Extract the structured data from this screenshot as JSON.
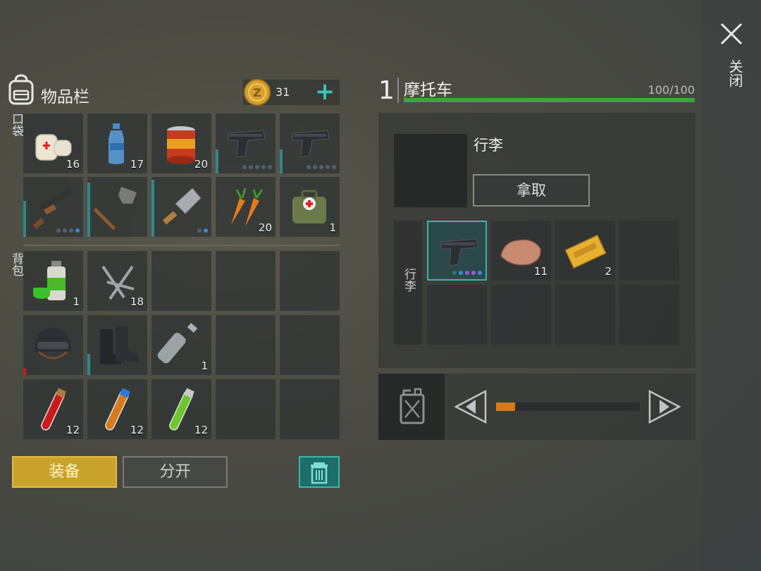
{
  "close": {
    "label": "关闭"
  },
  "inventory": {
    "title": "物品栏",
    "coins": "31",
    "pocket_label": "口袋",
    "backpack_label": "背包",
    "pocket_slots": [
      {
        "icon": "bandage-icon",
        "qty": "16"
      },
      {
        "icon": "water-bottle-icon",
        "qty": "17"
      },
      {
        "icon": "canned-food-icon",
        "qty": "20"
      },
      {
        "icon": "pistol-icon",
        "qty": ""
      },
      {
        "icon": "pistol-icon",
        "qty": ""
      },
      {
        "icon": "shotgun-icon",
        "qty": ""
      },
      {
        "icon": "shovel-icon",
        "qty": ""
      },
      {
        "icon": "cleaver-icon",
        "qty": ""
      },
      {
        "icon": "carrot-icon",
        "qty": "20"
      },
      {
        "icon": "medkit-bag-icon",
        "qty": "1"
      }
    ],
    "backpack_slots": [
      {
        "icon": "spray-paint-icon",
        "qty": "1"
      },
      {
        "icon": "nails-icon",
        "qty": "18"
      },
      {
        "icon": "",
        "qty": ""
      },
      {
        "icon": "",
        "qty": ""
      },
      {
        "icon": "",
        "qty": ""
      },
      {
        "icon": "helmet-icon",
        "qty": ""
      },
      {
        "icon": "boots-icon",
        "qty": ""
      },
      {
        "icon": "empty-bottle-icon",
        "qty": "1"
      },
      {
        "icon": "",
        "qty": ""
      },
      {
        "icon": "",
        "qty": ""
      },
      {
        "icon": "red-vial-icon",
        "qty": "12"
      },
      {
        "icon": "orange-vial-icon",
        "qty": "12"
      },
      {
        "icon": "green-vial-icon",
        "qty": "12"
      },
      {
        "icon": "",
        "qty": ""
      },
      {
        "icon": "",
        "qty": ""
      }
    ],
    "equip_label": "装备",
    "split_label": "分开"
  },
  "vehicle": {
    "number": "1",
    "name": "摩托车",
    "durability_text": "100/100",
    "durability_fraction": 1.0,
    "storage_name": "行李",
    "take_label": "拿取",
    "storage_side_label": "行李",
    "storage_slots": [
      {
        "icon": "pistol-icon",
        "qty": ""
      },
      {
        "icon": "ore-rock-icon",
        "qty": "11"
      },
      {
        "icon": "coupon-icon",
        "qty": "2"
      },
      {
        "icon": "",
        "qty": ""
      },
      {
        "icon": "",
        "qty": ""
      },
      {
        "icon": "",
        "qty": ""
      },
      {
        "icon": "",
        "qty": ""
      },
      {
        "icon": "",
        "qty": ""
      }
    ],
    "fuel_fraction": 0.13
  },
  "colors": {
    "accent_teal": "#38c4b4",
    "equip_gold": "#c9a22c",
    "durability_green": "#3aa83a",
    "fuel_orange": "#d67a18"
  }
}
